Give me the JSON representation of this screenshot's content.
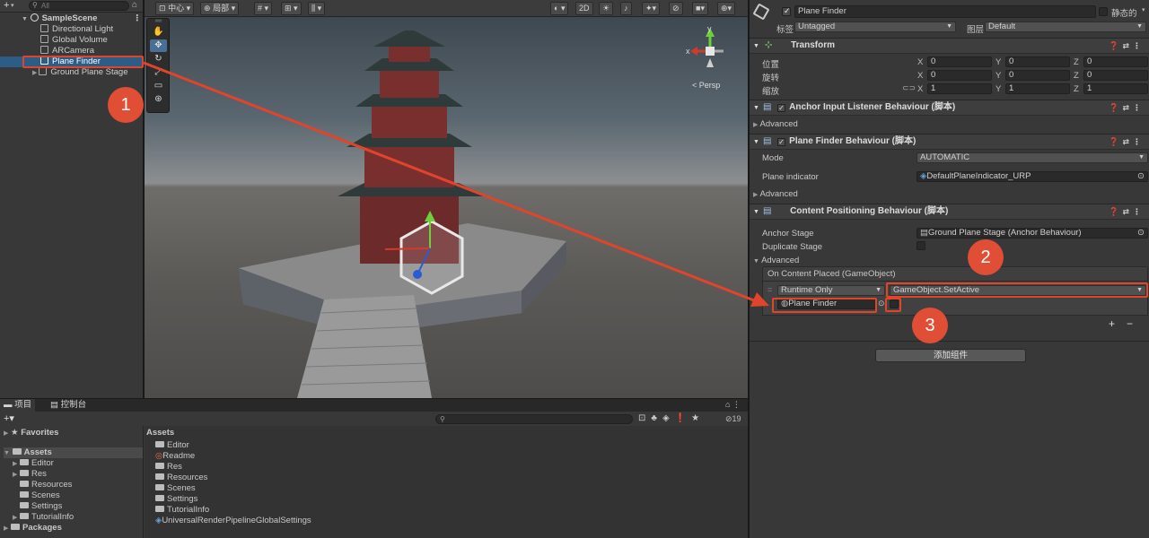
{
  "hierarchy": {
    "search_placeholder": "All",
    "add_label": "+",
    "scene_name": "SampleScene",
    "items": [
      "Directional Light",
      "Global Volume",
      "ARCamera",
      "Plane Finder",
      "Ground Plane Stage"
    ]
  },
  "scene_toolbar": {
    "pivot": "中心",
    "space": "局部",
    "mode_2d": "2D",
    "camera_label": "Persp",
    "gizmo_y": "y",
    "gizmo_x": "x"
  },
  "inspector": {
    "object_name": "Plane Finder",
    "static_label": "静态的",
    "tag_label": "标签",
    "tag_value": "Untagged",
    "layer_label": "图层",
    "layer_value": "Default",
    "transform": {
      "title": "Transform",
      "rows": [
        {
          "label": "位置",
          "x": "0",
          "y": "0",
          "z": "0"
        },
        {
          "label": "旋转",
          "x": "0",
          "y": "0",
          "z": "0"
        },
        {
          "label": "缩放",
          "x": "1",
          "y": "1",
          "z": "1"
        }
      ],
      "axis_x": "X",
      "axis_y": "Y",
      "axis_z": "Z"
    },
    "anchor_input": {
      "title": "Anchor Input Listener Behaviour",
      "script_tag": "(脚本)",
      "advanced": "Advanced"
    },
    "plane_finder": {
      "title": "Plane Finder Behaviour",
      "script_tag": "(脚本)",
      "mode_label": "Mode",
      "mode_value": "AUTOMATIC",
      "indicator_label": "Plane indicator",
      "indicator_value": "DefaultPlaneIndicator_URP",
      "advanced": "Advanced"
    },
    "content_pos": {
      "title": "Content Positioning Behaviour",
      "script_tag": "(脚本)",
      "anchor_stage_label": "Anchor Stage",
      "anchor_stage_value": "Ground Plane Stage (Anchor Behaviour)",
      "duplicate_label": "Duplicate Stage",
      "advanced": "Advanced",
      "event_title": "On Content Placed (GameObject)",
      "runtime_value": "Runtime Only",
      "function_value": "GameObject.SetActive",
      "target_value": "Plane Finder",
      "plus": "+",
      "minus": "−"
    },
    "add_component": "添加组件"
  },
  "bottom": {
    "tab_project": "项目",
    "tab_console": "控制台",
    "count": "19",
    "favorites": "Favorites",
    "assets": "Assets",
    "packages": "Packages",
    "tree": [
      "Editor",
      "Res",
      "Resources",
      "Scenes",
      "Settings",
      "TutorialInfo"
    ],
    "assets_header": "Assets",
    "files": [
      "Editor",
      "Readme",
      "Res",
      "Resources",
      "Scenes",
      "Settings",
      "TutorialInfo",
      "UniversalRenderPipelineGlobalSettings"
    ]
  },
  "annotations": {
    "badge1": "1",
    "badge2": "2",
    "badge3": "3"
  },
  "colors": {
    "accent_red": "#e0452c",
    "selection_blue": "#2c5d87"
  }
}
